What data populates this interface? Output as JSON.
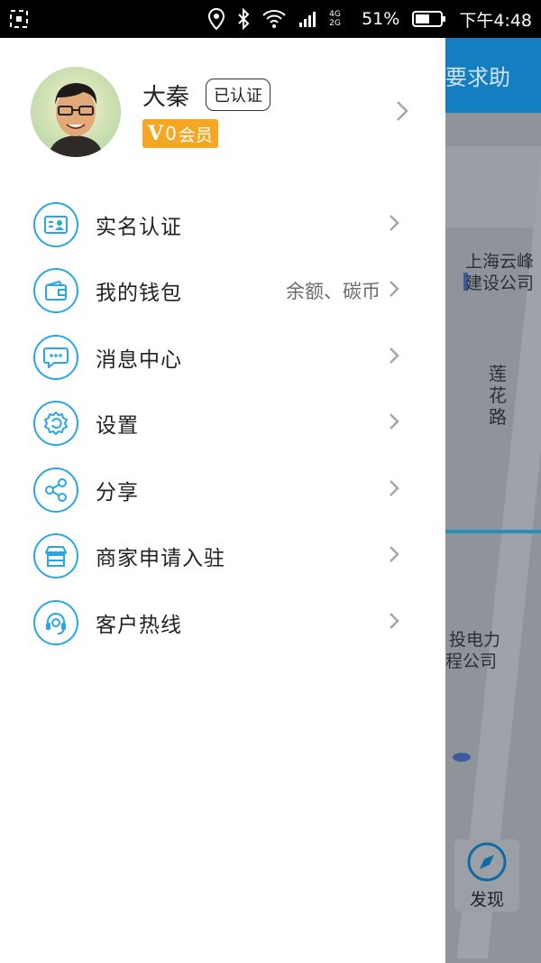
{
  "status_bar": {
    "network_label": "4G 2G",
    "battery": "51%",
    "time": "下午4:48"
  },
  "background": {
    "header_text": "我要求助",
    "labels": {
      "company1_line1": "上海云峰",
      "company1_line2": "建设公司",
      "road": "莲花路",
      "company2_line1": "投电力",
      "company2_line2": "程公司"
    },
    "discover_label": "发现"
  },
  "profile": {
    "name": "大秦",
    "verified_badge": "已认证",
    "vip_level": "0",
    "vip_text": "会员"
  },
  "menu": {
    "items": [
      {
        "label": "实名认证",
        "icon": "id-card-icon"
      },
      {
        "label": "我的钱包",
        "icon": "wallet-icon",
        "extra": "余额、碳币"
      },
      {
        "label": "消息中心",
        "icon": "message-icon"
      },
      {
        "label": "设置",
        "icon": "gear-icon"
      },
      {
        "label": "分享",
        "icon": "share-icon"
      },
      {
        "label": "商家申请入驻",
        "icon": "shop-icon"
      },
      {
        "label": "客户热线",
        "icon": "headset-icon"
      }
    ]
  },
  "colors": {
    "accent": "#2aa6e6",
    "vip": "#f5a623",
    "header_blue": "#137fc1"
  }
}
